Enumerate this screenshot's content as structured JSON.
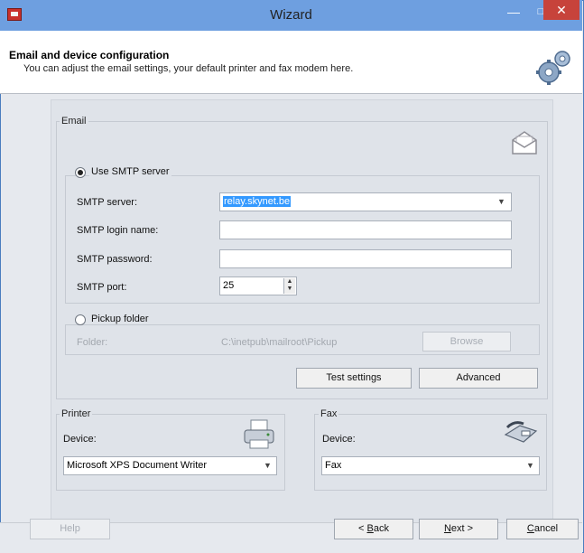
{
  "window": {
    "title": "Wizard"
  },
  "header": {
    "title": "Email and device configuration",
    "subtitle": "You can adjust the email settings, your default printer and fax modem here."
  },
  "email": {
    "group_label": "Email",
    "use_smtp_label": "Use SMTP server",
    "smtp_server_label": "SMTP server:",
    "smtp_server_value": "relay.skynet.be",
    "smtp_login_label": "SMTP login name:",
    "smtp_login_value": "",
    "smtp_password_label": "SMTP password:",
    "smtp_password_value": "",
    "smtp_port_label": "SMTP port:",
    "smtp_port_value": "25",
    "pickup_label": "Pickup folder",
    "folder_label": "Folder:",
    "folder_value": "C:\\inetpub\\mailroot\\Pickup",
    "browse_label": "Browse",
    "test_settings_label": "Test settings",
    "advanced_label": "Advanced"
  },
  "printer": {
    "group_label": "Printer",
    "device_label": "Device:",
    "device_value": "Microsoft XPS Document Writer"
  },
  "fax": {
    "group_label": "Fax",
    "device_label": "Device:",
    "device_value": "Fax"
  },
  "footer": {
    "help_label": "Help",
    "back_prefix": "< ",
    "back_access": "B",
    "back_rest": "ack",
    "next_access": "N",
    "next_rest": "ext >",
    "cancel_access": "C",
    "cancel_rest": "ancel"
  },
  "colors": {
    "titlebar": "#6e9fe0",
    "close": "#c7433b",
    "selection": "#3399ff"
  },
  "icons": [
    "app-icon",
    "minimize-icon",
    "maximize-icon",
    "close-icon",
    "gears-icon",
    "envelope-icon",
    "printer-icon",
    "fax-icon",
    "chevron-down-icon",
    "spinner-icon"
  ]
}
